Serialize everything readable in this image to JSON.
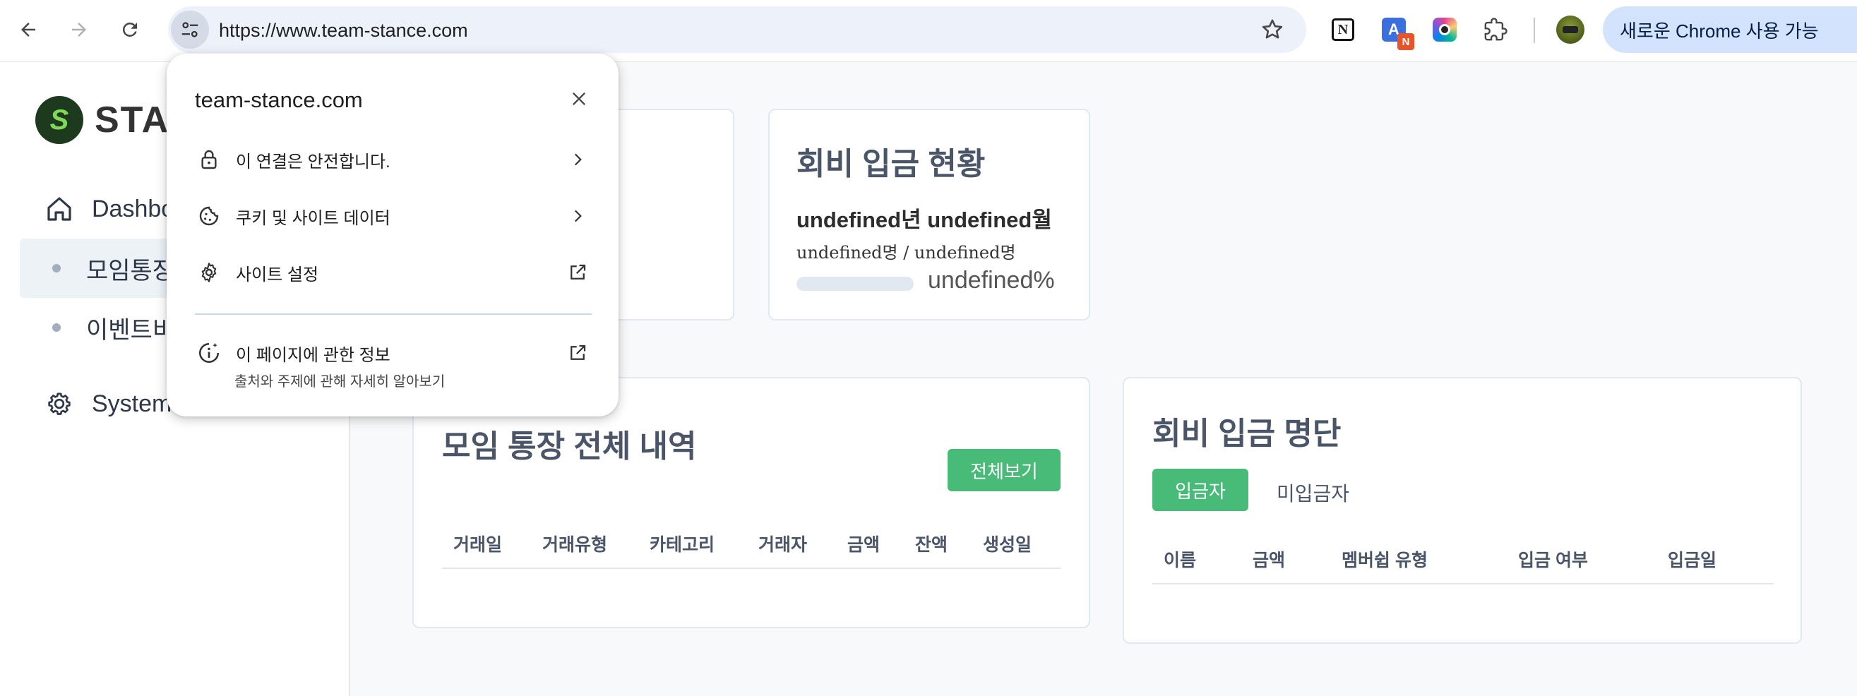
{
  "browser": {
    "url": "https://www.team-stance.com",
    "update_label": "새로운 Chrome 사용 가능",
    "ext_badge": "N",
    "notion_letter": "N"
  },
  "app": {
    "logo_letter": "S",
    "logo_text": "STANCE",
    "sidebar": {
      "items": [
        {
          "label": "Dashboard"
        },
        {
          "label": "모임통장"
        },
        {
          "label": "이벤트비"
        },
        {
          "label": "System"
        }
      ]
    },
    "dues_status": {
      "title": "회비 입금 현황",
      "period": "undefined년 undefined월",
      "count": "undefined명 / undefined명",
      "percent": "undefined%",
      "progress": 0
    },
    "account_history": {
      "title": "모임 통장 전체 내역",
      "view_all": "전체보기",
      "columns": [
        "거래일",
        "거래유형",
        "카테고리",
        "거래자",
        "금액",
        "잔액",
        "생성일"
      ]
    },
    "dues_list": {
      "title": "회비 입금 명단",
      "tabs": [
        "입금자",
        "미입금자"
      ],
      "columns": [
        "이름",
        "금액",
        "멤버쉽 유형",
        "입금 여부",
        "입금일"
      ]
    }
  },
  "site_info_popup": {
    "domain": "team-stance.com",
    "connection": "이 연결은 안전합니다.",
    "cookies": "쿠키 및 사이트 데이터",
    "site_settings": "사이트 설정",
    "page_info": "이 페이지에 관한 정보",
    "page_info_sub": "출처와 주제에 관해 자세히 알아보기"
  },
  "colors": {
    "accent_green": "#48bb78",
    "omnibox_bg": "#edf2fa",
    "update_pill_bg": "#d3e3fd"
  }
}
